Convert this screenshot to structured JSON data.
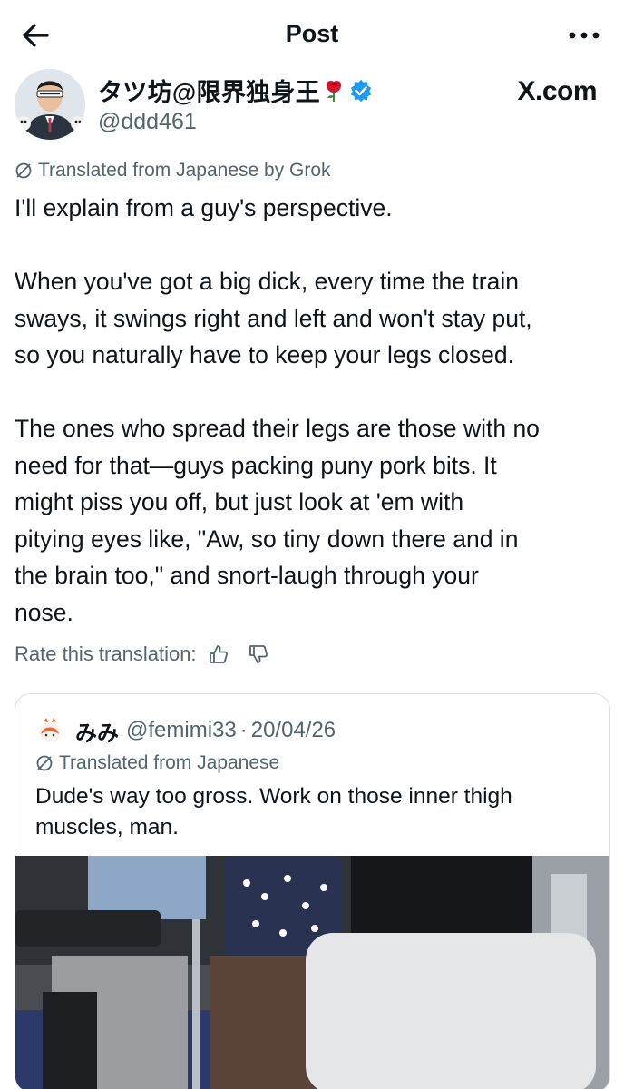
{
  "header": {
    "title": "Post",
    "back_icon": "arrow-left-icon",
    "more_icon": "more-horizontal-icon"
  },
  "author": {
    "name": "タツ坊@限界独身王",
    "handle": "@ddd461",
    "badge_emoji": "rose-icon",
    "verified_color": "#1d9bf0",
    "watermark": "X.com"
  },
  "post": {
    "translated_label": "Translated from Japanese by Grok",
    "paragraphs": [
      [
        "I'll explain from a guy's perspective."
      ],
      [
        "When you've got a big dick, every time the train",
        "sways, it swings right and left and won't stay put,",
        "so you naturally have to keep your legs closed."
      ],
      [
        "The ones who spread their legs are those with no",
        "need for that—guys packing puny pork bits. It",
        "might piss you off, but just look at 'em with",
        "pitying eyes like, \"Aw, so tiny down there and in",
        "the brain too,\" and snort-laugh through your",
        "nose."
      ]
    ],
    "rate_label": "Rate this translation:"
  },
  "quote": {
    "name": "みみ",
    "handle": "@femimi33",
    "separator": "·",
    "date": "20/04/26",
    "translated_label": "Translated from Japanese",
    "text_lines": [
      "Dude's way too gross. Work on those inner thigh",
      "muscles, man."
    ]
  },
  "colors": {
    "text": "#0f1419",
    "secondary": "#536471",
    "border": "#d9dee2",
    "accent": "#1d9bf0"
  }
}
